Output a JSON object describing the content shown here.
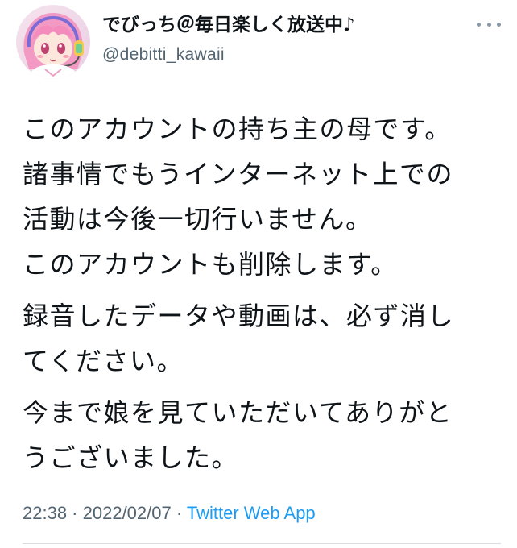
{
  "tweet": {
    "author": {
      "display_name": "でびっち＠毎日楽しく放送中♪",
      "handle": "@debitti_kawaii",
      "avatar_icon": "anime-avatar-icon"
    },
    "more_icon": "more-options-icon",
    "paragraphs": [
      {
        "lines": [
          "このアカウントの持ち主の母です。",
          "諸事情でもうインターネット上での",
          "活動は今後一切行いません。",
          "このアカウントも削除します。"
        ]
      },
      {
        "lines": [
          "録音したデータや動画は、必ず消し",
          "てください。"
        ]
      },
      {
        "lines": [
          "今まで娘を見ていただいてありがと",
          "うございました。"
        ]
      }
    ],
    "meta": {
      "time": "22:38",
      "separator": " · ",
      "date": "2022/02/07",
      "source": "Twitter Web App"
    }
  },
  "colors": {
    "text": "#0f1419",
    "secondary": "#536471",
    "link": "#1d9bf0",
    "divider": "#d9dde1"
  }
}
